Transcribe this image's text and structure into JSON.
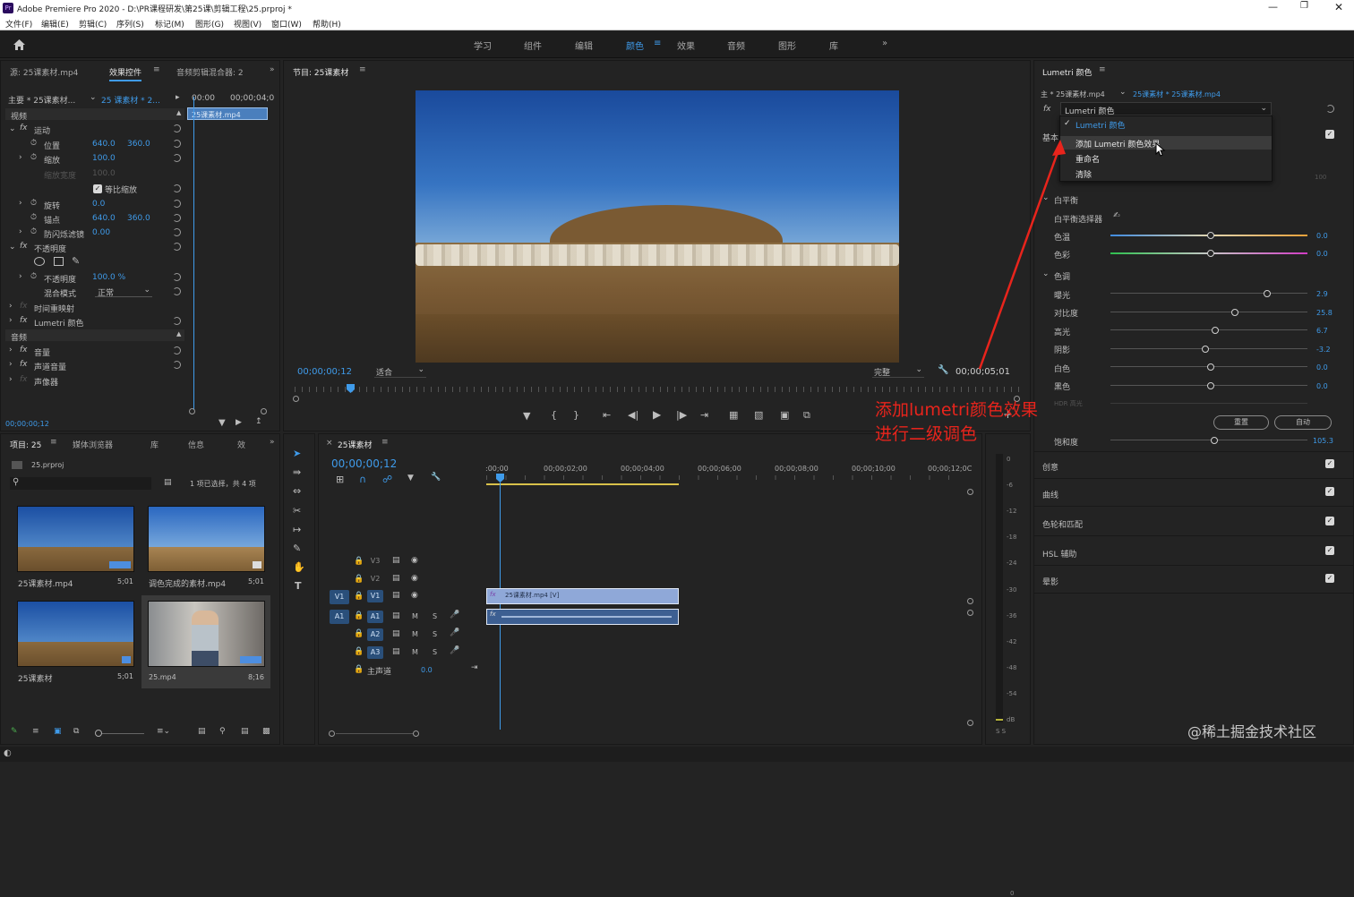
{
  "title_bar": {
    "app_badge": "Pr",
    "text": "Adobe Premiere Pro 2020 - D:\\PR课程研发\\第25课\\剪辑工程\\25.prproj *"
  },
  "menu": [
    "文件(F)",
    "编辑(E)",
    "剪辑(C)",
    "序列(S)",
    "标记(M)",
    "图形(G)",
    "视图(V)",
    "窗口(W)",
    "帮助(H)"
  ],
  "workspaces": [
    "学习",
    "组件",
    "编辑",
    "颜色",
    "效果",
    "音频",
    "图形",
    "库"
  ],
  "workspace_active": "颜色",
  "effect_controls": {
    "tabs": [
      "源: 25课素材.mp4",
      "效果控件",
      "音频剪辑混合器: 2"
    ],
    "master": "主要 * 25课素材...",
    "clip": "25 课素材 * 2...",
    "time_start": "00:00",
    "time_end": "00;00;04;0",
    "clip_bar": "25课素材.mp4",
    "video_header": "视频",
    "motion": "运动",
    "position_label": "位置",
    "position_x": "640.0",
    "position_y": "360.0",
    "scale_label": "缩放",
    "scale_val": "100.0",
    "scale_width_label": "缩放宽度",
    "scale_width_val": "100.0",
    "uniform_label": "等比缩放",
    "rotation_label": "旋转",
    "rotation_val": "0.0",
    "anchor_label": "锚点",
    "anchor_x": "640.0",
    "anchor_y": "360.0",
    "flicker_label": "防闪烁滤镜",
    "flicker_val": "0.00",
    "opacity_header": "不透明度",
    "opacity_label": "不透明度",
    "opacity_val": "100.0 %",
    "blend_label": "混合模式",
    "blend_val": "正常",
    "time_remap": "时间重映射",
    "lumetri": "Lumetri 颜色",
    "audio_header": "音频",
    "volume": "音量",
    "channel_volume": "声道音量",
    "panner": "声像器",
    "timecode": "00;00;00;12"
  },
  "program_monitor": {
    "title": "节目: 25课素材",
    "timecode": "00;00;00;12",
    "fit": "适合",
    "quality": "完整",
    "duration": "00;00;05;01"
  },
  "project_panel": {
    "tabs": [
      "项目: 25",
      "媒体浏览器",
      "库",
      "信息",
      "效"
    ],
    "project_file": "25.prproj",
    "selection": "1 项已选择，共 4 项",
    "items": [
      {
        "name": "25课素材.mp4",
        "dur": "5;01"
      },
      {
        "name": "调色完成的素材.mp4",
        "dur": "5;01"
      },
      {
        "name": "25课素材",
        "dur": "5;01"
      },
      {
        "name": "25.mp4",
        "dur": "8;16"
      }
    ]
  },
  "timeline": {
    "title": "25课素材",
    "timecode": "00;00;00;12",
    "ruler": [
      ":00;00",
      "00;00;02;00",
      "00;00;04;00",
      "00;00;06;00",
      "00;00;08;00",
      "00;00;10;00",
      "00;00;12;0C"
    ],
    "tracks": [
      "V3",
      "V2",
      "V1",
      "A1",
      "A2",
      "A3"
    ],
    "master_label": "主声道",
    "master_val": "0.0",
    "video_clip": "25课素材.mp4 [V]"
  },
  "meter_labels": [
    "0",
    "-6",
    "-12",
    "-18",
    "-24",
    "-30",
    "-36",
    "-42",
    "-48",
    "-54",
    "dB"
  ],
  "meter_bottom": "S S",
  "lumetri": {
    "panel_title": "Lumetri 颜色",
    "master": "主 * 25课素材.mp4",
    "clip": "25课素材 * 25课素材.mp4",
    "dropdown": "Lumetri 颜色",
    "menu_checked": "Lumetri 颜色",
    "menu_items": [
      "添加 Lumetri 颜色效果",
      "重命名",
      "清除"
    ],
    "basic_label": "基本",
    "wb_header": "白平衡",
    "wb_picker": "白平衡选择器",
    "temp_label": "色温",
    "temp_val": "0.0",
    "tint_label": "色彩",
    "tint_val": "0.0",
    "tone_header": "色调",
    "exposure_label": "曝光",
    "exposure_val": "2.9",
    "contrast_label": "对比度",
    "contrast_val": "25.8",
    "highlights_label": "高光",
    "highlights_val": "6.7",
    "shadows_label": "阴影",
    "shadows_val": "-3.2",
    "whites_label": "白色",
    "whites_val": "0.0",
    "blacks_label": "黑色",
    "blacks_val": "0.0",
    "hdr_label": "HDR 高光",
    "hidden_val": "100",
    "reset_btn": "重置",
    "auto_btn": "自动",
    "saturation_label": "饱和度",
    "saturation_val": "105.3",
    "sections": [
      "创意",
      "曲线",
      "色轮和匹配",
      "HSL 辅助",
      "晕影"
    ]
  },
  "annotation": {
    "line1": "添加lumetri颜色效果",
    "line2": "进行二级调色",
    "color": "#e8241c"
  },
  "watermark": "@稀土掘金技术社区"
}
